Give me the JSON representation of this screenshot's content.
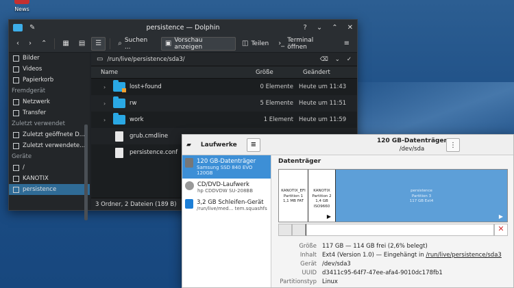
{
  "desktop": {
    "news_label": "News"
  },
  "dolphin": {
    "title": "persistence — Dolphin",
    "toolbar": {
      "search": "Suchen ...",
      "preview": "Vorschau anzeigen",
      "split": "Teilen",
      "terminal": "Terminal öffnen"
    },
    "path": "/run/live/persistence/sda3/",
    "columns": {
      "name": "Name",
      "size": "Größe",
      "modified": "Geändert"
    },
    "sidebar": {
      "items_top": [
        "Bilder",
        "Videos",
        "Papierkorb"
      ],
      "group_remote": "Fremdgerät",
      "remote_items": [
        "Netzwerk",
        "Transfer"
      ],
      "group_recent": "Zuletzt verwendet",
      "recent_items": [
        "Zuletzt geöffnete D...",
        "Zuletzt verwendete..."
      ],
      "group_devices": "Geräte",
      "device_items": [
        "/",
        "KANOTIX",
        "persistence"
      ]
    },
    "files": [
      {
        "name": "lost+found",
        "size": "0 Elemente",
        "date": "Heute um 11:43",
        "type": "folder-locked"
      },
      {
        "name": "rw",
        "size": "5 Elemente",
        "date": "Heute um 11:51",
        "type": "folder"
      },
      {
        "name": "work",
        "size": "1 Element",
        "date": "Heute um 11:59",
        "type": "folder"
      },
      {
        "name": "grub.cmdline",
        "size": "",
        "date": "",
        "type": "file"
      },
      {
        "name": "persistence.conf",
        "size": "",
        "date": "",
        "type": "file"
      }
    ],
    "status": "3 Ordner, 2 Dateien (189 B)"
  },
  "laufwerke": {
    "title": "Laufwerke",
    "drive_title": "120 GB-Datenträger",
    "drive_sub": "/dev/sda",
    "drives": [
      {
        "name": "120 GB-Datenträger",
        "sub": "Samsung SSD 840 EVO 120GB"
      },
      {
        "name": "CD/DVD-Laufwerk",
        "sub": "hp          CDDVDW SU-208BB"
      },
      {
        "name": "3,2 GB Schleifen-Gerät",
        "sub": "/run/live/med... tem.squashfs"
      }
    ],
    "section": "Datenträger",
    "partitions": [
      {
        "name": "KANOTIX_EFI",
        "sub1": "Partition 1",
        "sub2": "1,1 MB FAT"
      },
      {
        "name": "KANOTIX",
        "sub1": "Partition 2",
        "sub2": "1,4 GB ISO9660"
      },
      {
        "name": "persistence",
        "sub1": "Partition 3",
        "sub2": "117 GB Ext4"
      }
    ],
    "props": [
      {
        "k": "Größe",
        "v": "117 GB — 114 GB frei (2,6% belegt)"
      },
      {
        "k": "Inhalt",
        "v": "Ext4 (Version 1.0) — Eingehängt in ",
        "link": "/run/live/persistence/sda3"
      },
      {
        "k": "Gerät",
        "v": "/dev/sda3"
      },
      {
        "k": "UUID",
        "v": "d3411c95-64f7-47ee-afa4-9010dc178fb1"
      },
      {
        "k": "Partitionstyp",
        "v": "Linux"
      }
    ]
  }
}
